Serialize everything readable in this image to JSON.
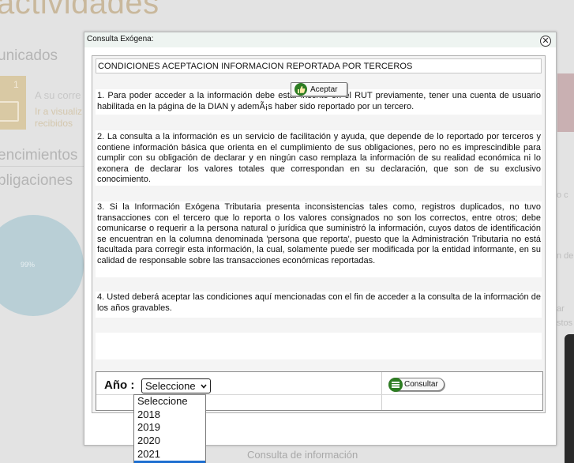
{
  "background": {
    "title": "actividades",
    "section_comunicados": "unicados",
    "card_number": "1",
    "card_link1": "A su corre",
    "card_link2": "Ir a visualiz",
    "card_link3": "recibidos",
    "section_vencimientos": "encimientos",
    "section_obligaciones": "bligaciones",
    "pie_label": "99%",
    "right_snippet_1": "o c",
    "right_snippet_2": "n de",
    "right_snippet_3": "ar",
    "right_snippet_4": "stos",
    "footer_link": "Consulta de información"
  },
  "dialog": {
    "title": "Consulta Exógena:",
    "close_symbol": "✕",
    "header": "CONDICIONES ACEPTACION INFORMACION REPORTADA POR TERCEROS",
    "paragraphs": [
      "1. Para poder acceder a la información debe estar inscrito en el RUT previamente, tener una cuenta de usuario habilitada en la página de la DIAN y ademÃ¡s haber sido reportado por un tercero.",
      "2. La consulta a la información es un servicio de facilitación y ayuda, que depende de lo reportado por terceros y contiene información básica que orienta en el cumplimiento de sus obligaciones, pero no es imprescindible para cumplir con su obligación de declarar y en ningún caso remplaza la información de su realidad económica ni lo exonera de declarar los valores totales que correspondan en su declaración, que son de su exclusivo conocimiento.",
      "3. Si la Información Exógena Tributaria presenta inconsistencias tales como, registros duplicados, no tuvo transacciones con el tercero que lo reporta o los valores consignados no son los correctos, entre otros; debe comunicarse o requerir a la persona natural o jurídica que suministró la información, cuyos datos de identificación se encuentran en la columna denominada 'persona que reporta', puesto que la Administración Tributaria no está facultada para corregir esta información, la cual, solamente puede ser modificada por la entidad informante, en su calidad de responsable sobre las transacciones económicas reportadas.",
      "4. Usted deberá aceptar las condiciones aquí mencionadas con el fin de acceder a la consulta de la información de los años gravables."
    ],
    "accept_label": "Aceptar",
    "year_label": "Año :",
    "year_selected": "Seleccione",
    "query_label": "Consultar",
    "year_options": [
      "Seleccione",
      "2018",
      "2019",
      "2020",
      "2021"
    ]
  },
  "colors": {
    "accent_green": "#2e7d23",
    "dropdown_highlight": "#1e6fd0"
  }
}
